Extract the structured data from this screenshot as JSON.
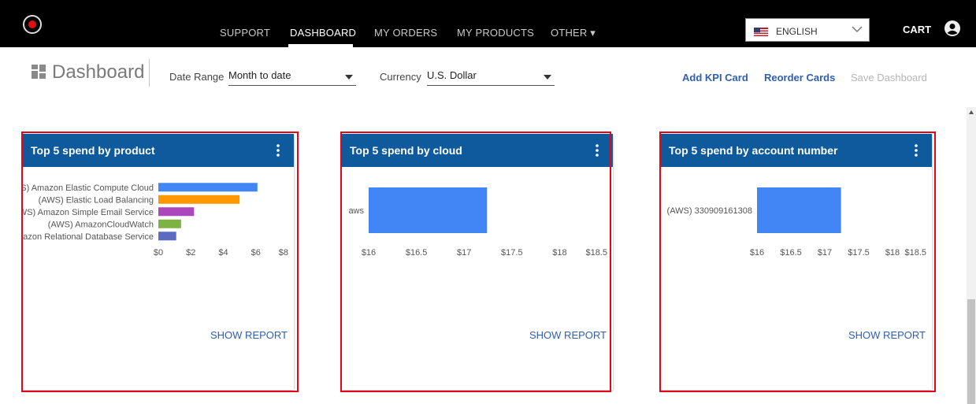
{
  "nav": {
    "items": [
      {
        "label": "SUPPORT"
      },
      {
        "label": "DASHBOARD",
        "active": true
      },
      {
        "label": "MY ORDERS"
      },
      {
        "label": "MY PRODUCTS"
      },
      {
        "label": "OTHER ▾"
      }
    ],
    "language": "ENGLISH",
    "cart": "CART"
  },
  "toolbar": {
    "title": "Dashboard",
    "date_range_label": "Date Range",
    "date_range_value": "Month to date",
    "currency_label": "Currency",
    "currency_value": "U.S. Dollar",
    "add_kpi": "Add KPI Card",
    "reorder": "Reorder Cards",
    "save": "Save Dashboard"
  },
  "cards": [
    {
      "title": "Top 5 spend by product",
      "show_report": "SHOW REPORT"
    },
    {
      "title": "Top 5 spend by cloud",
      "show_report": "SHOW REPORT"
    },
    {
      "title": "Top 5 spend by account number",
      "show_report": "SHOW REPORT"
    }
  ],
  "colors": {
    "nav_bg": "#000000",
    "card_header": "#0e5a9c",
    "link": "#2f5fb2",
    "highlight": "#e0071b",
    "bar_blue": "#4285f4"
  },
  "chart_data": [
    {
      "type": "bar",
      "orientation": "horizontal",
      "categories": [
        "(AWS) Amazon Elastic Compute Cloud",
        "(AWS) Elastic Load Balancing",
        "(AWS) Amazon Simple Email Service",
        "(AWS) AmazonCloudWatch",
        "(AWS) Amazon Relational Database Service"
      ],
      "values": [
        6.1,
        5.0,
        2.2,
        1.4,
        1.1
      ],
      "colors": [
        "#4285f4",
        "#ff9800",
        "#ab47bc",
        "#7cb342",
        "#5c6bc0"
      ],
      "xticks": [
        "$0",
        "$2",
        "$4",
        "$6",
        "$8"
      ],
      "xlim": [
        0,
        8
      ]
    },
    {
      "type": "bar",
      "orientation": "horizontal",
      "categories": [
        "aws"
      ],
      "values": [
        17.24
      ],
      "colors": [
        "#4285f4"
      ],
      "xticks": [
        "$16",
        "$16.5",
        "$17",
        "$17.5",
        "$18",
        "$18.5"
      ],
      "xlim": [
        16,
        18.5
      ]
    },
    {
      "type": "bar",
      "orientation": "horizontal",
      "categories": [
        "(AWS) 330909161308"
      ],
      "values": [
        17.24
      ],
      "colors": [
        "#4285f4"
      ],
      "xticks": [
        "$16",
        "$16.5",
        "$17",
        "$17.5",
        "$18",
        "$18.5"
      ],
      "xlim": [
        16,
        18.5
      ]
    }
  ]
}
